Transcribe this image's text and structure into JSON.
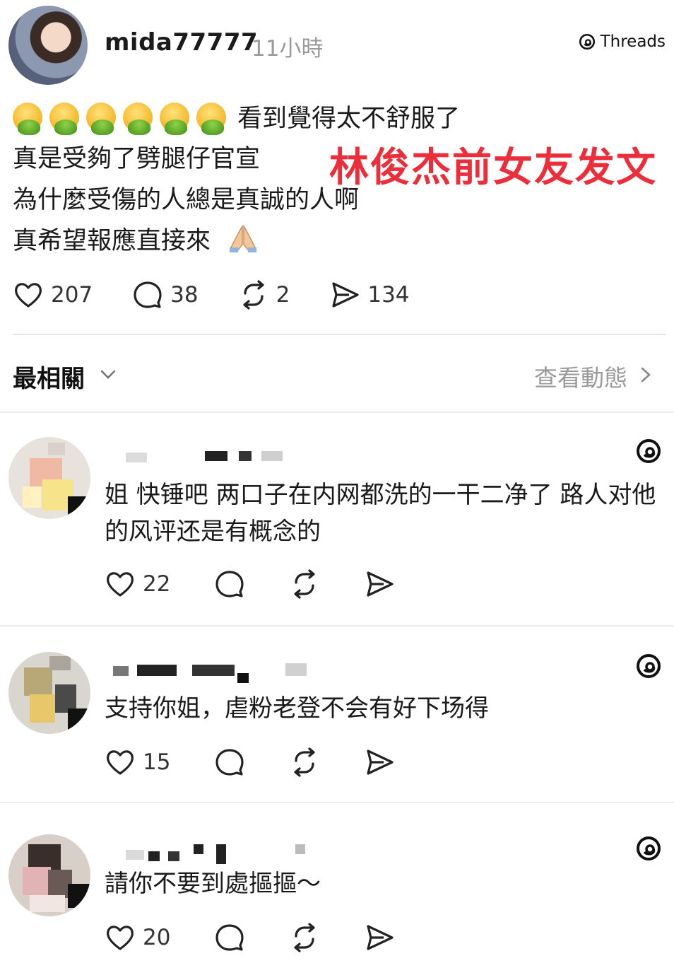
{
  "post": {
    "username": "mida77777",
    "time": "11小時",
    "brand": "Threads",
    "lines": [
      "看到覺得太不舒服了",
      "真是受夠了劈腿仔官宣",
      "為什麼受傷的人總是真誠的人啊",
      "真希望報應直接來"
    ],
    "overlay_caption": "林俊杰前女友发文",
    "stats": {
      "likes": "207",
      "comments": "38",
      "reposts": "2",
      "shares": "134"
    },
    "emoji_icons": [
      "nauseated-face",
      "nauseated-face",
      "nauseated-face",
      "nauseated-face",
      "nauseated-face",
      "nauseated-face",
      "folded-hands"
    ]
  },
  "sort_bar": {
    "label": "最相關",
    "activity_link": "查看動態"
  },
  "comments": [
    {
      "text": "姐 快锤吧 两口子在内网都洗的一干二净了 路人对他的风评还是有概念的",
      "likes": "22"
    },
    {
      "text": "支持你姐，虐粉老登不会有好下场得",
      "likes": "15"
    },
    {
      "text": "請你不要到處摳摳～",
      "likes": "20"
    }
  ],
  "colors": {
    "caption_red": "#ec2d3a",
    "muted_text": "#9a9a9a",
    "divider": "#e6e6e6"
  }
}
